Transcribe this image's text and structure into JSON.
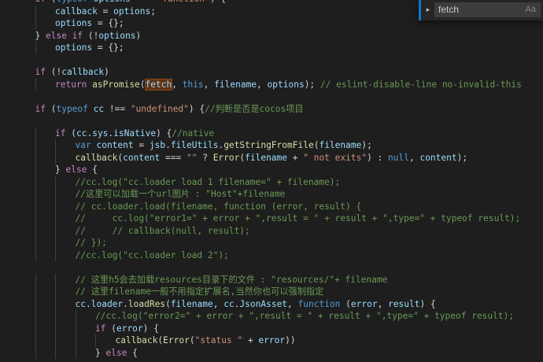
{
  "find_widget": {
    "query": "fetch",
    "match_case_label": "Aa",
    "toggle_icon": "chevron-right-icon"
  },
  "theme": {
    "background": "#1e1e1e",
    "keyword": "#569cd6",
    "control": "#c586c0",
    "function": "#dcdcaa",
    "variable": "#9cdcfe",
    "string": "#ce9178",
    "comment": "#6a9955",
    "find_match": "#613214"
  },
  "code": {
    "lines": [
      {
        "indent": 1,
        "tokens": [
          [
            "control",
            "if"
          ],
          [
            "plain",
            " ("
          ],
          [
            "keyword",
            "typeof"
          ],
          [
            "plain",
            " "
          ],
          [
            "variable",
            "options"
          ],
          [
            "plain",
            " === "
          ],
          [
            "string",
            "\"function\""
          ],
          [
            "plain",
            ") {"
          ]
        ]
      },
      {
        "indent": 2,
        "tokens": [
          [
            "variable",
            "callback"
          ],
          [
            "plain",
            " = "
          ],
          [
            "variable",
            "options"
          ],
          [
            "plain",
            ";"
          ]
        ]
      },
      {
        "indent": 2,
        "tokens": [
          [
            "variable",
            "options"
          ],
          [
            "plain",
            " = {};"
          ]
        ]
      },
      {
        "indent": 1,
        "tokens": [
          [
            "plain",
            "} "
          ],
          [
            "control",
            "else"
          ],
          [
            "plain",
            " "
          ],
          [
            "control",
            "if"
          ],
          [
            "plain",
            " (!"
          ],
          [
            "variable",
            "options"
          ],
          [
            "plain",
            ")"
          ]
        ]
      },
      {
        "indent": 2,
        "tokens": [
          [
            "variable",
            "options"
          ],
          [
            "plain",
            " = {};"
          ]
        ]
      },
      {
        "indent": 0,
        "tokens": []
      },
      {
        "indent": 1,
        "tokens": [
          [
            "control",
            "if"
          ],
          [
            "plain",
            " (!"
          ],
          [
            "variable",
            "callback"
          ],
          [
            "plain",
            ")"
          ]
        ]
      },
      {
        "indent": 2,
        "tokens": [
          [
            "control",
            "return"
          ],
          [
            "plain",
            " "
          ],
          [
            "function",
            "asPromise"
          ],
          [
            "plain",
            "("
          ],
          [
            "match",
            "fetch"
          ],
          [
            "plain",
            ", "
          ],
          [
            "keyword",
            "this"
          ],
          [
            "plain",
            ", "
          ],
          [
            "variable",
            "filename"
          ],
          [
            "plain",
            ", "
          ],
          [
            "variable",
            "options"
          ],
          [
            "plain",
            "); "
          ],
          [
            "comment",
            "// eslint-disable-line no-invalid-this"
          ]
        ]
      },
      {
        "indent": 0,
        "tokens": []
      },
      {
        "indent": 1,
        "tokens": [
          [
            "control",
            "if"
          ],
          [
            "plain",
            " ("
          ],
          [
            "keyword",
            "typeof"
          ],
          [
            "plain",
            " "
          ],
          [
            "variable",
            "cc"
          ],
          [
            "plain",
            " !== "
          ],
          [
            "string",
            "\"undefined\""
          ],
          [
            "plain",
            ") {"
          ],
          [
            "comment",
            "//判断是否是cocos项目"
          ]
        ]
      },
      {
        "indent": 0,
        "tokens": []
      },
      {
        "indent": 2,
        "tokens": [
          [
            "control",
            "if"
          ],
          [
            "plain",
            " ("
          ],
          [
            "variable",
            "cc"
          ],
          [
            "plain",
            "."
          ],
          [
            "variable",
            "sys"
          ],
          [
            "plain",
            "."
          ],
          [
            "variable",
            "isNative"
          ],
          [
            "plain",
            ") {"
          ],
          [
            "comment",
            "//native"
          ]
        ]
      },
      {
        "indent": 3,
        "tokens": [
          [
            "keyword",
            "var"
          ],
          [
            "plain",
            " "
          ],
          [
            "variable",
            "content"
          ],
          [
            "plain",
            " = "
          ],
          [
            "variable",
            "jsb"
          ],
          [
            "plain",
            "."
          ],
          [
            "variable",
            "fileUtils"
          ],
          [
            "plain",
            "."
          ],
          [
            "function",
            "getStringFromFile"
          ],
          [
            "plain",
            "("
          ],
          [
            "variable",
            "filename"
          ],
          [
            "plain",
            ");"
          ]
        ]
      },
      {
        "indent": 3,
        "tokens": [
          [
            "function",
            "callback"
          ],
          [
            "plain",
            "("
          ],
          [
            "variable",
            "content"
          ],
          [
            "plain",
            " === "
          ],
          [
            "string",
            "\"\""
          ],
          [
            "plain",
            " ? "
          ],
          [
            "function",
            "Error"
          ],
          [
            "plain",
            "("
          ],
          [
            "variable",
            "filename"
          ],
          [
            "plain",
            " + "
          ],
          [
            "string",
            "\" not exits\""
          ],
          [
            "plain",
            ") : "
          ],
          [
            "keyword",
            "null"
          ],
          [
            "plain",
            ", "
          ],
          [
            "variable",
            "content"
          ],
          [
            "plain",
            ");"
          ]
        ]
      },
      {
        "indent": 2,
        "tokens": [
          [
            "plain",
            "} "
          ],
          [
            "control",
            "else"
          ],
          [
            "plain",
            " {"
          ]
        ]
      },
      {
        "indent": 3,
        "tokens": [
          [
            "comment",
            "//cc.log(\"cc.loader load 1 filename=\" + filename);"
          ]
        ]
      },
      {
        "indent": 3,
        "tokens": [
          [
            "comment",
            "//这里可以加载一个url图片 : \"Host\"+filename"
          ]
        ]
      },
      {
        "indent": 3,
        "tokens": [
          [
            "comment",
            "// cc.loader.load(filename, function (error, result) {"
          ]
        ]
      },
      {
        "indent": 3,
        "tokens": [
          [
            "comment",
            "//     cc.log(\"error1=\" + error + \",result = \" + result + \",type=\" + typeof result);"
          ]
        ]
      },
      {
        "indent": 3,
        "tokens": [
          [
            "comment",
            "//     // callback(null, result);"
          ]
        ]
      },
      {
        "indent": 3,
        "tokens": [
          [
            "comment",
            "// });"
          ]
        ]
      },
      {
        "indent": 3,
        "tokens": [
          [
            "comment",
            "//cc.log(\"cc.loader load 2\");"
          ]
        ]
      },
      {
        "indent": 0,
        "tokens": []
      },
      {
        "indent": 3,
        "tokens": [
          [
            "comment",
            "// 这里h5会去加载resources目录下的文件 : \"resources/\"+ filename"
          ]
        ]
      },
      {
        "indent": 3,
        "tokens": [
          [
            "comment",
            "// 这里filename一般不用指定扩展名,当然你也可以强制指定"
          ]
        ]
      },
      {
        "indent": 3,
        "tokens": [
          [
            "variable",
            "cc"
          ],
          [
            "plain",
            "."
          ],
          [
            "variable",
            "loader"
          ],
          [
            "plain",
            "."
          ],
          [
            "function",
            "loadRes"
          ],
          [
            "plain",
            "("
          ],
          [
            "variable",
            "filename"
          ],
          [
            "plain",
            ", "
          ],
          [
            "variable",
            "cc"
          ],
          [
            "plain",
            "."
          ],
          [
            "variable",
            "JsonAsset"
          ],
          [
            "plain",
            ", "
          ],
          [
            "keyword",
            "function"
          ],
          [
            "plain",
            " ("
          ],
          [
            "variable",
            "error"
          ],
          [
            "plain",
            ", "
          ],
          [
            "variable",
            "result"
          ],
          [
            "plain",
            ") {"
          ]
        ]
      },
      {
        "indent": 4,
        "tokens": [
          [
            "comment",
            "//cc.log(\"error2=\" + error + \",result = \" + result + \",type=\" + typeof result);"
          ]
        ]
      },
      {
        "indent": 4,
        "tokens": [
          [
            "control",
            "if"
          ],
          [
            "plain",
            " ("
          ],
          [
            "variable",
            "error"
          ],
          [
            "plain",
            ") {"
          ]
        ]
      },
      {
        "indent": 5,
        "tokens": [
          [
            "function",
            "callback"
          ],
          [
            "plain",
            "("
          ],
          [
            "function",
            "Error"
          ],
          [
            "plain",
            "("
          ],
          [
            "string",
            "\"status \""
          ],
          [
            "plain",
            " + "
          ],
          [
            "variable",
            "error"
          ],
          [
            "plain",
            "))"
          ]
        ]
      },
      {
        "indent": 4,
        "tokens": [
          [
            "plain",
            "} "
          ],
          [
            "control",
            "else"
          ],
          [
            "plain",
            " {"
          ]
        ]
      }
    ]
  }
}
